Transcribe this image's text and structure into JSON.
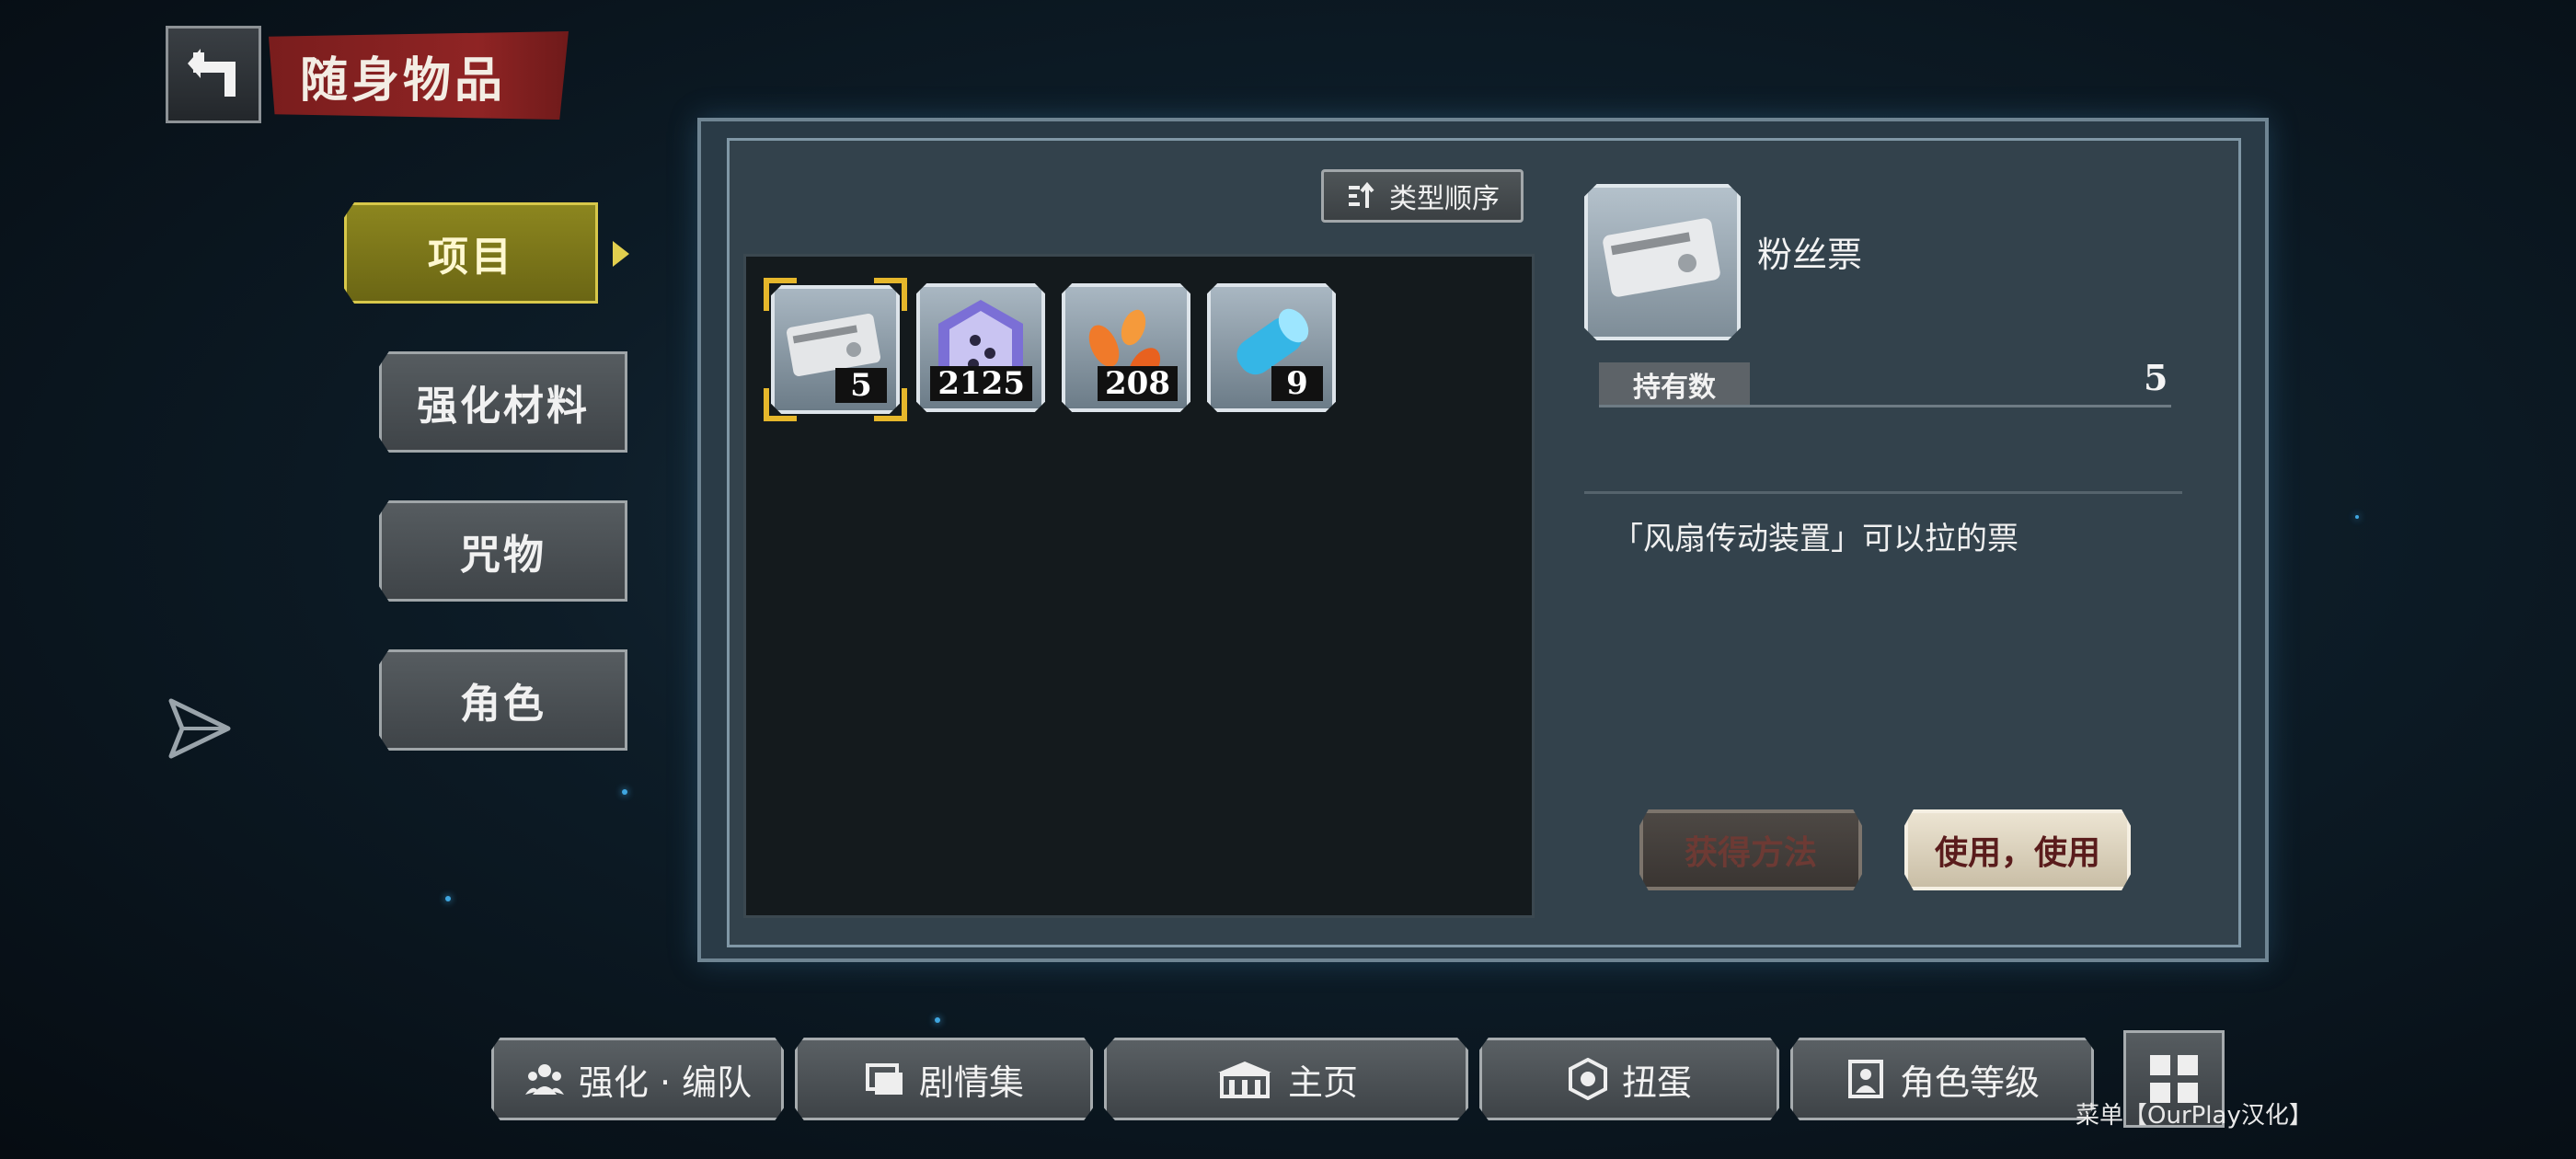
{
  "header": {
    "title": "随身物品"
  },
  "tabs": [
    {
      "label": "项目",
      "active": true
    },
    {
      "label": "强化材料",
      "active": false
    },
    {
      "label": "咒物",
      "active": false
    },
    {
      "label": "角色",
      "active": false
    }
  ],
  "sort": {
    "label": "类型顺序"
  },
  "items": [
    {
      "icon": "ticket-icon",
      "count": "5",
      "selected": true
    },
    {
      "icon": "crystal-dice-icon",
      "count": "2125",
      "selected": false
    },
    {
      "icon": "orange-petals-icon",
      "count": "208",
      "selected": false
    },
    {
      "icon": "blue-scroll-icon",
      "count": "9",
      "selected": false
    }
  ],
  "detail": {
    "name": "粉丝票",
    "hold_label": "持有数",
    "hold_value": "5",
    "description": "「风扇传动装置」可以拉的票",
    "obtain_label": "获得方法",
    "use_label": "使用，使用"
  },
  "nav": [
    {
      "label": "强化 · 编队",
      "icon": "team-icon"
    },
    {
      "label": "剧情集",
      "icon": "story-icon"
    },
    {
      "label": "主页",
      "icon": "home-icon"
    },
    {
      "label": "扭蛋",
      "icon": "gacha-icon"
    },
    {
      "label": "角色等级",
      "icon": "character-level-icon"
    }
  ],
  "menu": {
    "label": "菜单【OurPlay汉化】",
    "icon": "grid-menu-icon"
  },
  "colors": {
    "title_banner": "#8f2424",
    "active_tab": "#8c861f",
    "selection": "#e6b72b"
  }
}
